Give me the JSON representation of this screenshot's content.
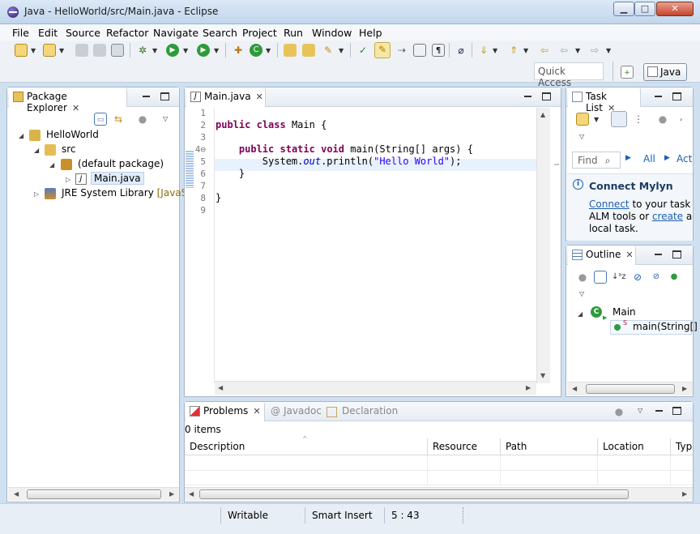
{
  "window": {
    "title": "Java - HelloWorld/src/Main.java - Eclipse",
    "min": "▁",
    "max": "□",
    "close": "✕"
  },
  "menu": [
    "File",
    "Edit",
    "Source",
    "Refactor",
    "Navigate",
    "Search",
    "Project",
    "Run",
    "Window",
    "Help"
  ],
  "toolbar": {
    "icons": [
      "new-icon",
      "new-wizard-icon",
      "save-icon",
      "save-all-icon",
      "print-icon",
      "debug-icon",
      "run-icon",
      "run-ext-icon",
      "new-java-project-icon",
      "new-package-icon",
      "open-type-icon",
      "open-task-icon",
      "search-icon",
      "next-annotation-icon",
      "prev-annotation-icon",
      "toggle-mark-icon",
      "block-selection-icon",
      "toggle-breadcrumb-icon",
      "show-whitespace-icon",
      "pin-icon",
      "next-edit-icon",
      "prev-edit-icon",
      "last-edit-icon",
      "back-icon",
      "forward-icon"
    ],
    "quick_access_placeholder": "Quick Access",
    "perspective": "Java"
  },
  "package_explorer": {
    "tab_label": "Package Explorer",
    "tree": [
      {
        "label": "HelloWorld"
      },
      {
        "label": "src"
      },
      {
        "label": "(default package)"
      },
      {
        "label": "Main.java"
      },
      {
        "label": "JRE System Library",
        "suffix": "[JavaSE-"
      }
    ]
  },
  "editor": {
    "tab_label": "Main.java",
    "lines": [
      {
        "n": "1",
        "parts": []
      },
      {
        "n": "2",
        "parts": [
          {
            "t": "public",
            "c": "kw"
          },
          {
            "t": " "
          },
          {
            "t": "class",
            "c": "kw"
          },
          {
            "t": " Main {"
          }
        ]
      },
      {
        "n": "3",
        "parts": []
      },
      {
        "n": "4⊖",
        "parts": [
          {
            "t": "    "
          },
          {
            "t": "public",
            "c": "kw"
          },
          {
            "t": " "
          },
          {
            "t": "static",
            "c": "kw"
          },
          {
            "t": " "
          },
          {
            "t": "void",
            "c": "kw"
          },
          {
            "t": " main(String[] args) {"
          }
        ]
      },
      {
        "n": "5",
        "parts": [
          {
            "t": "        System."
          },
          {
            "t": "out",
            "c": "fld"
          },
          {
            "t": ".println("
          },
          {
            "t": "\"Hello World\"",
            "c": "str"
          },
          {
            "t": ");"
          }
        ]
      },
      {
        "n": "6",
        "parts": [
          {
            "t": "    }"
          }
        ]
      },
      {
        "n": "7",
        "parts": []
      },
      {
        "n": "8",
        "parts": [
          {
            "t": "}"
          }
        ]
      },
      {
        "n": "9",
        "parts": []
      }
    ]
  },
  "task_list": {
    "tab_label": "Task List",
    "find_placeholder": "Find",
    "all": "All",
    "act": "Act",
    "mylyn_title": "Connect Mylyn",
    "mylyn_connect": "Connect",
    "mylyn_text1": " to your task ar",
    "mylyn_text2": "ALM tools or ",
    "mylyn_create": "create",
    "mylyn_text3": " a",
    "mylyn_text4": "local task."
  },
  "outline": {
    "tab_label": "Outline",
    "class_name": "Main",
    "method": "main(String[]"
  },
  "problems": {
    "tabs": [
      "Problems",
      "Javadoc",
      "Declaration"
    ],
    "count": "0 items",
    "columns": [
      "Description",
      "Resource",
      "Path",
      "Location",
      "Typ"
    ]
  },
  "status": {
    "writable": "Writable",
    "insert_mode": "Smart Insert",
    "position": "5 : 43"
  },
  "colors": {
    "keyword": "#7f0055",
    "string": "#2a00ff",
    "field": "#0000c0",
    "current_line": "#e8f2fe",
    "link": "#1a5fb4"
  }
}
